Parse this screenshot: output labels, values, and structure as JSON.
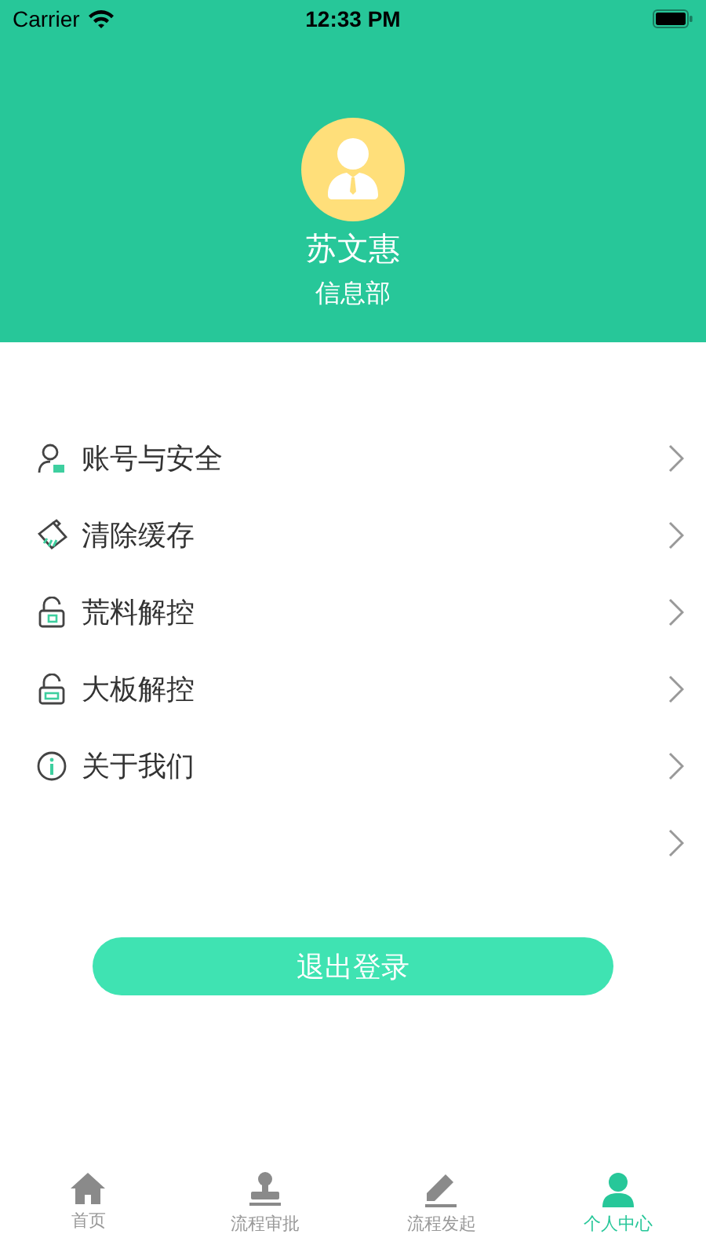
{
  "status_bar": {
    "carrier": "Carrier",
    "time": "12:33 PM"
  },
  "profile": {
    "name": "苏文惠",
    "department": "信息部"
  },
  "menu": [
    {
      "kind": "account",
      "label": "账号与安全"
    },
    {
      "kind": "broom",
      "label": "清除缓存"
    },
    {
      "kind": "lock-box",
      "label": "荒料解控"
    },
    {
      "kind": "lock-slab",
      "label": "大板解控"
    },
    {
      "kind": "info",
      "label": "关于我们"
    },
    {
      "kind": "blank"
    }
  ],
  "logout_button": "退出登录",
  "tabs": [
    {
      "kind": "home",
      "label": "首页",
      "selected": false
    },
    {
      "kind": "stamp",
      "label": "流程审批",
      "selected": false
    },
    {
      "kind": "pen",
      "label": "流程发起",
      "selected": false
    },
    {
      "kind": "person",
      "label": "个人中心",
      "selected": true
    }
  ]
}
